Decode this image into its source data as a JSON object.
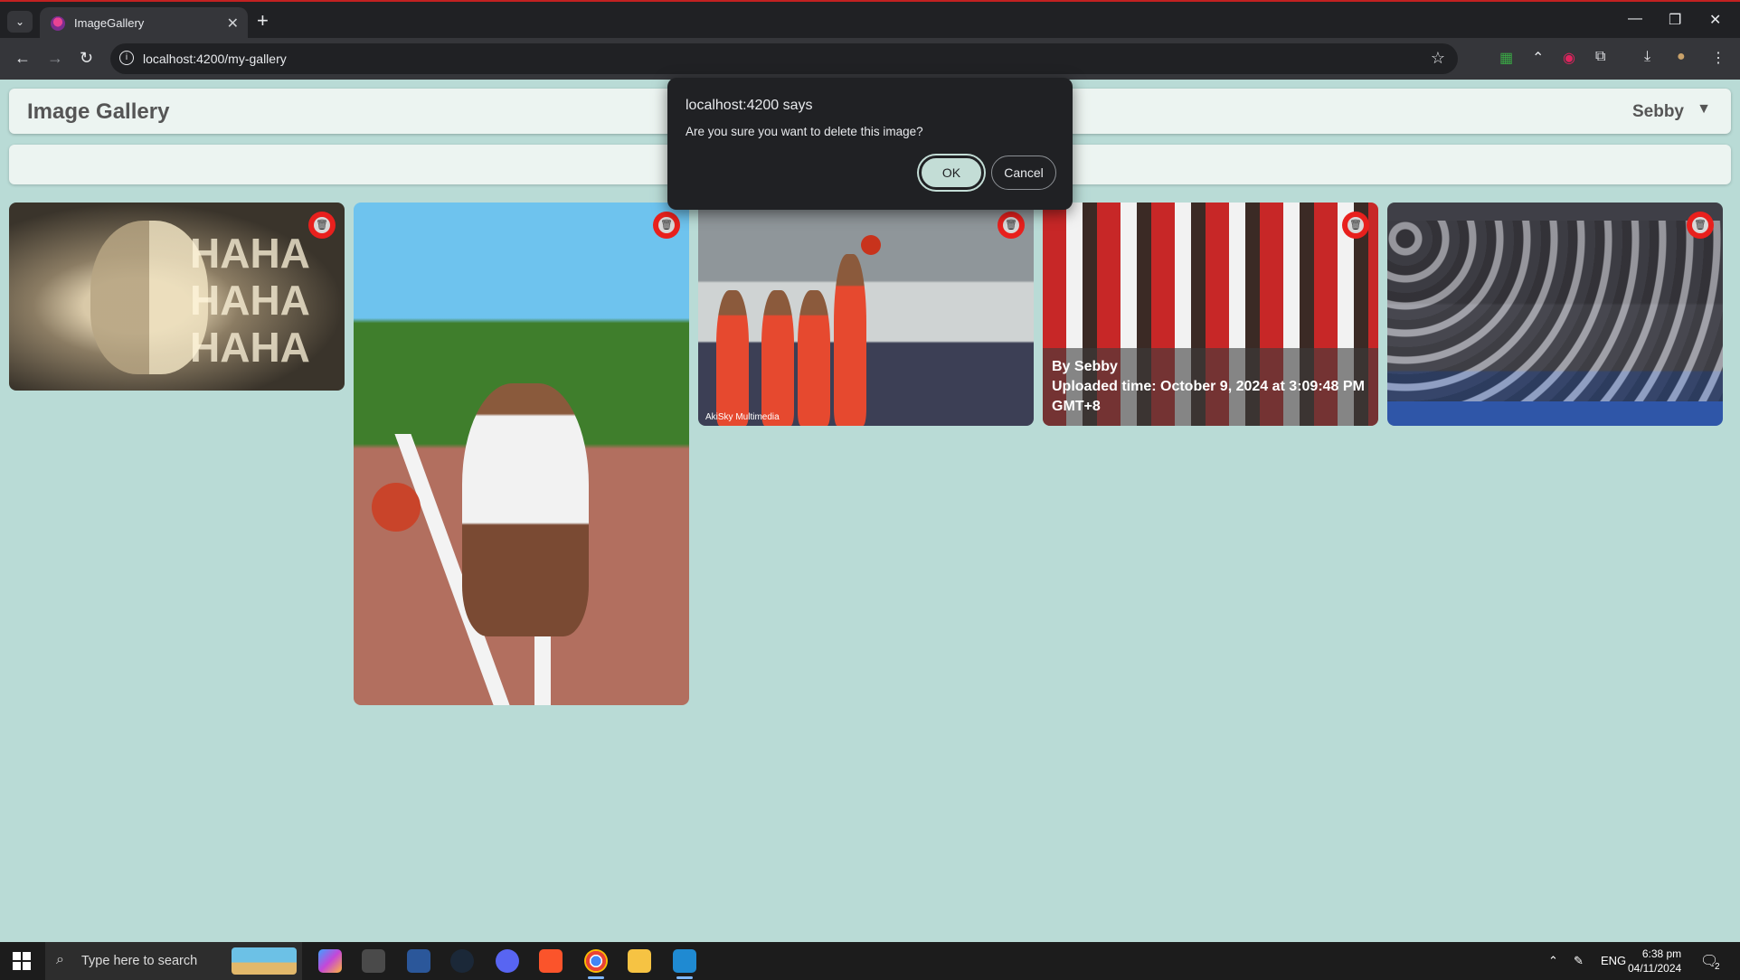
{
  "browser": {
    "tab_title": "ImageGallery",
    "url": "localhost:4200/my-gallery"
  },
  "app": {
    "title": "Image Gallery",
    "user_name": "Sebby",
    "caret": "▼"
  },
  "gallery": {
    "overlay_author": "By Sebby",
    "overlay_uploaded": "Uploaded time: October 9, 2024 at 3:09:48 PM GMT+8",
    "watermark": "AkiSky Multimedia",
    "joker_text": "HAHA HAHA HAHA"
  },
  "dialog": {
    "title": "localhost:4200 says",
    "message": "Are you sure you want to delete this image?",
    "ok_label": "OK",
    "cancel_label": "Cancel"
  },
  "taskbar": {
    "search_placeholder": "Type here to search",
    "language": "ENG",
    "time": "6:38 pm",
    "date": "04/11/2024",
    "notification_count": "2"
  },
  "colors": {
    "page_bg": "#b9dbd6",
    "card_bg": "#ecf4f1",
    "delete_red": "#e8201d",
    "ok_button": "#c3ddd6"
  }
}
